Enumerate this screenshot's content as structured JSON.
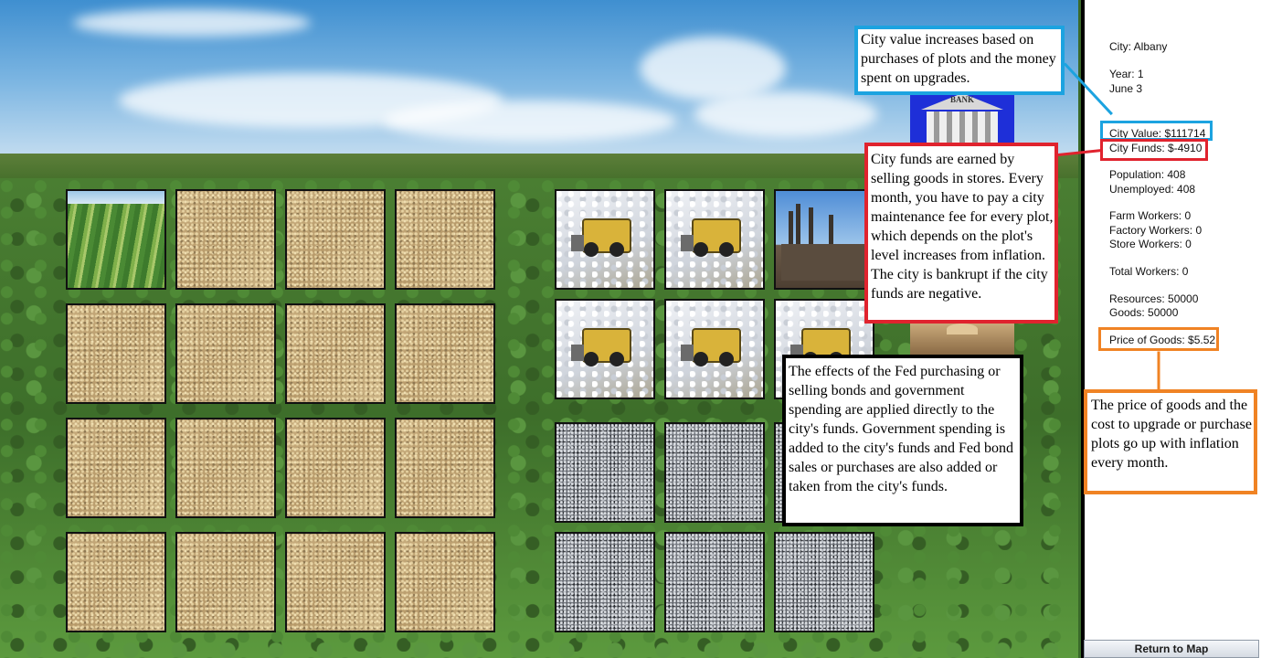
{
  "sidebar": {
    "city": "City: Albany",
    "year": "Year: 1",
    "date": "June 3",
    "city_value": "City Value:  $111714",
    "city_funds": "City Funds: $-4910",
    "population": "Population: 408",
    "unemployed": "Unemployed: 408",
    "farm_workers": "Farm Workers: 0",
    "factory_workers": "Factory Workers: 0",
    "store_workers": "Store Workers: 0",
    "total_workers": "Total Workers: 0",
    "resources": "Resources: 50000",
    "goods": "Goods: 50000",
    "price_of_goods": "Price of Goods: $5.52",
    "return_button": "Return to Map"
  },
  "tooltips": {
    "city_value": "City value increases based on purchases of plots and the money spent on upgrades.",
    "city_funds": "City funds are earned by selling goods in stores. Every month, you have to pay a city maintenance fee for every plot, which depends on the plot's level increases from inflation. The city is bankrupt if the city funds are negative.",
    "fed_effects": "The effects of the Fed purchasing or selling bonds and government spending are applied directly to the city's funds. Government spending is added to the city's funds and Fed bond sales or purchases are also added or taken from the city's funds.",
    "price_of_goods": "The price of goods and the cost to upgrade or purchase plots go up with inflation every month."
  },
  "map": {
    "bank_label": "BANK",
    "left_grid": [
      [
        "farm",
        "empty",
        "empty",
        "empty"
      ],
      [
        "empty",
        "empty",
        "empty",
        "empty"
      ],
      [
        "empty",
        "empty",
        "empty",
        "empty"
      ],
      [
        "empty",
        "empty",
        "empty",
        "empty"
      ]
    ],
    "right_grid": [
      [
        "construction",
        "construction",
        "factory"
      ],
      [
        "construction",
        "construction",
        "construction"
      ],
      [
        "gravel",
        "gravel",
        "gravel"
      ],
      [
        "gravel",
        "gravel",
        "gravel"
      ]
    ]
  },
  "colors": {
    "city_value_callout": "#1ca3e0",
    "city_funds_callout": "#e0232e",
    "fed_callout": "#000000",
    "price_callout": "#f08324",
    "bank_tile": "#1e2fd8"
  }
}
